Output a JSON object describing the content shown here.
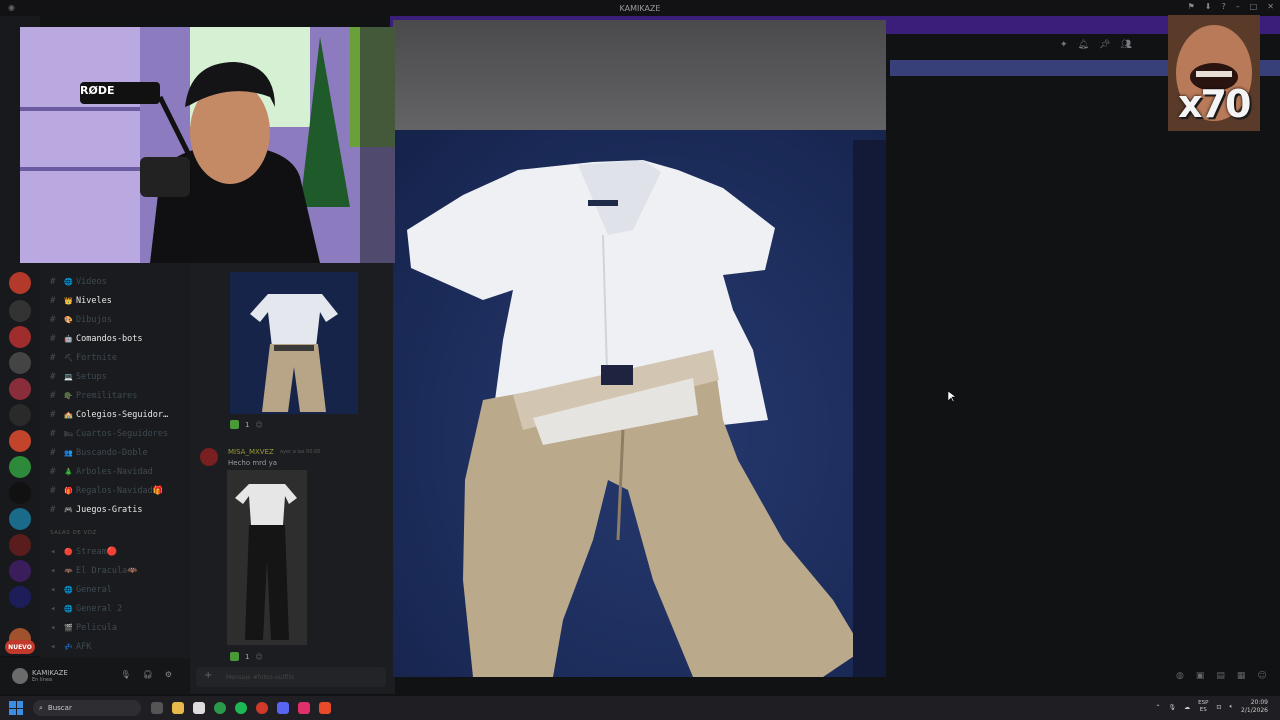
{
  "window": {
    "title": "KAMIKAZE"
  },
  "sidebar": {
    "channels": [
      {
        "name": "Videos",
        "emoji": "🌐",
        "style": "dim"
      },
      {
        "name": "Niveles",
        "emoji": "👑",
        "style": "bright"
      },
      {
        "name": "Dibujos",
        "emoji": "🎨",
        "style": "dim"
      },
      {
        "name": "Comandos-bots",
        "emoji": "🤖",
        "style": "bright"
      },
      {
        "name": "Fortnite",
        "emoji": "⛏",
        "style": "dim"
      },
      {
        "name": "Setups",
        "emoji": "💻",
        "style": "dim"
      },
      {
        "name": "Premilitares",
        "emoji": "🪖",
        "style": "dim"
      },
      {
        "name": "Colegios-Seguidor…",
        "emoji": "🏫",
        "style": "bright"
      },
      {
        "name": "Cuartos-Seguidores",
        "emoji": "🛏",
        "style": "dim"
      },
      {
        "name": "Buscando-Doble",
        "emoji": "👥",
        "style": "dim"
      },
      {
        "name": "Arboles-Navidad",
        "emoji": "🎄",
        "style": "dim"
      },
      {
        "name": "Regalos-Navidad🎁",
        "emoji": "🎁",
        "style": "dim"
      },
      {
        "name": "Juegos-Gratis",
        "emoji": "🎮",
        "style": "bright"
      }
    ],
    "voice_header": "SALAS DE VOZ",
    "voice_channels": [
      {
        "name": "Stream🔴",
        "emoji": "🔴"
      },
      {
        "name": "El Dracula🦇",
        "emoji": "🦇"
      },
      {
        "name": "General",
        "emoji": "🌐"
      },
      {
        "name": "General 2",
        "emoji": "🌐"
      },
      {
        "name": "Pelicula",
        "emoji": "🎬"
      },
      {
        "name": "AFK",
        "emoji": "💤"
      }
    ],
    "new_badge": "NUEVO"
  },
  "user": {
    "name": "KAMIKAZE",
    "status": "En línea"
  },
  "chat": {
    "reaction_count_1": "1",
    "message": {
      "username": "MISA_MXVEZ",
      "time": "ayer a las 00:00",
      "text": "Hecho mrd ya"
    },
    "reaction_count_2": "1",
    "input_placeholder": "Mensaje #fotos-outfits"
  },
  "webcam": {
    "mic_brand": "RØDE",
    "mic_label": "RØDE"
  },
  "overlay": {
    "multiplier": "x70"
  },
  "taskbar": {
    "search_placeholder": "Buscar",
    "lang_top": "ESP",
    "lang_bottom": "ES",
    "time": "20:09",
    "date": "2/1/2026"
  },
  "colors": {
    "accent_purple": "#3b1d7a",
    "bed_blue": "#1d2e5d",
    "start_blue": "#3a8ee6"
  }
}
